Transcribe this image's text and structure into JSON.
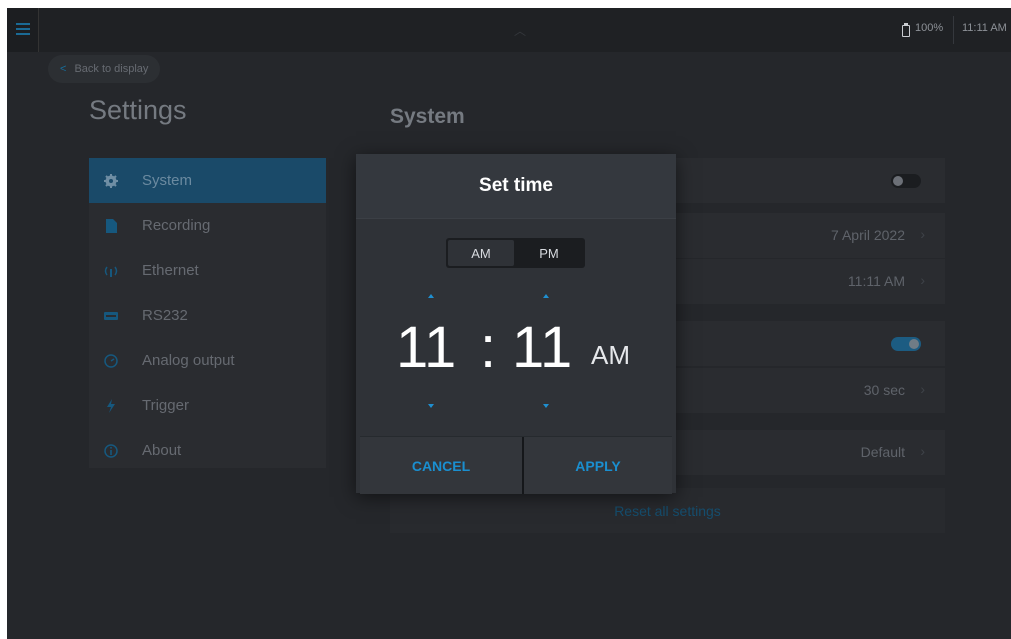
{
  "status_bar": {
    "battery": "100%",
    "time": "11:11 AM"
  },
  "back_button": {
    "label": "Back to display"
  },
  "settings_title": "Settings",
  "section_title": "System",
  "sidebar": {
    "items": [
      {
        "label": "System",
        "icon": "gear-icon",
        "active": true
      },
      {
        "label": "Recording",
        "icon": "file-icon"
      },
      {
        "label": "Ethernet",
        "icon": "antenna-icon"
      },
      {
        "label": "RS232",
        "icon": "port-icon"
      },
      {
        "label": "Analog output",
        "icon": "gauge-icon"
      },
      {
        "label": "Trigger",
        "icon": "lightning-icon"
      },
      {
        "label": "About",
        "icon": "info-icon"
      }
    ]
  },
  "system_panel": {
    "date_value": "7 April 2022",
    "time_value": "11:11 AM",
    "timeout_value": "30 sec",
    "default_value": "Default",
    "reset_label": "Reset all settings",
    "toggle_first_on": false,
    "toggle_second_on": true
  },
  "dialog": {
    "title": "Set time",
    "am_label": "AM",
    "pm_label": "PM",
    "selected_period": "AM",
    "hour": "11",
    "separator": ":",
    "minute": "11",
    "suffix": "AM",
    "cancel_label": "CANCEL",
    "apply_label": "APPLY"
  },
  "colors": {
    "accent": "#1f8fd0",
    "background": "#25272b",
    "dialog": "#2f3237"
  }
}
